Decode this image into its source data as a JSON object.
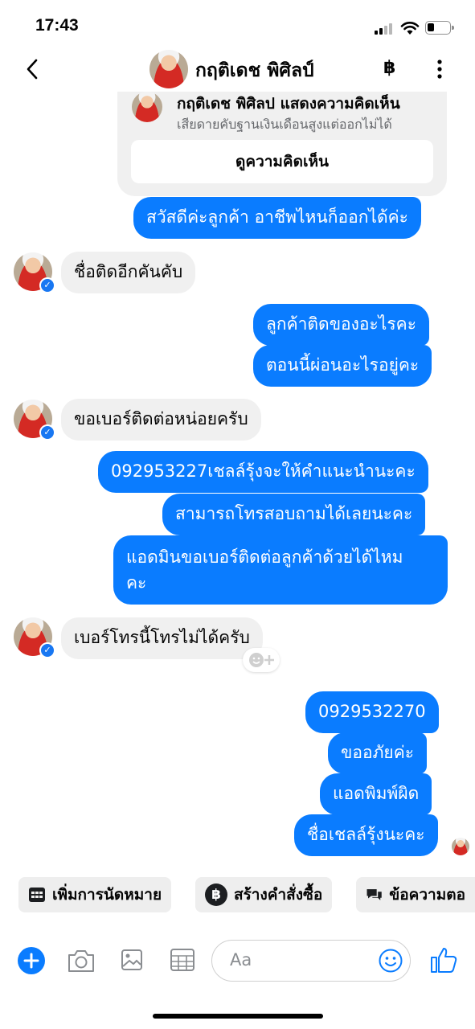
{
  "status_bar": {
    "time": "17:43"
  },
  "header": {
    "contact_name": "กฤติเดช พิศิลป์",
    "baht_symbol": "฿"
  },
  "shared_post": {
    "title": "กฤติเดช พิศิลป แสดงความคิดเห็น",
    "comment": "เสียดายคับฐานเงินเดือนสูงแต่ออกไม่ได้",
    "view_button": "ดูความคิดเห็น"
  },
  "messages": [
    {
      "side": "out",
      "text": "สวัสดีค่ะลูกค้า อาชีพไหนก็ออกได้ค่ะ"
    },
    {
      "side": "in",
      "text": "ชื่อติดอีกคันคับ"
    },
    {
      "side": "out",
      "text": "ลูกค้าติดของอะไรคะ"
    },
    {
      "side": "out",
      "text": "ตอนนี้ผ่อนอะไรอยู่คะ"
    },
    {
      "side": "in",
      "text": "ขอเบอร์ติดต่อหน่อยครับ"
    },
    {
      "side": "out",
      "text": "092953227เชลล์รุ้งจะให้คำแนะนำนะคะ"
    },
    {
      "side": "out",
      "text": "สามารถโทรสอบถามได้เลยนะคะ"
    },
    {
      "side": "out",
      "text": "แอดมินขอเบอร์ติดต่อลูกค้าด้วยได้ไหม"
    },
    {
      "side": "out",
      "text": "คะ"
    },
    {
      "side": "in",
      "text": "เบอร์โทรนี้โทรไม่ได้ครับ"
    },
    {
      "side": "out",
      "text": "0929532270"
    },
    {
      "side": "out",
      "text": "ขออภัยค่ะ"
    },
    {
      "side": "out",
      "text": "แอดพิมพ์ผิด"
    },
    {
      "side": "out",
      "text": "ชื่อเชลล์รุ้งนะคะ"
    }
  ],
  "quick_actions": [
    {
      "label": "เพิ่มการนัดหมาย",
      "icon": "calendar-icon"
    },
    {
      "label": "สร้างคำสั่งซื้อ",
      "icon": "baht-icon"
    },
    {
      "label": "ข้อความตอ",
      "icon": "chat-bubbles-icon"
    }
  ],
  "composer": {
    "placeholder": "Aa"
  },
  "colors": {
    "accent": "#0a7cff",
    "incoming_bg": "#f0f0f0"
  }
}
